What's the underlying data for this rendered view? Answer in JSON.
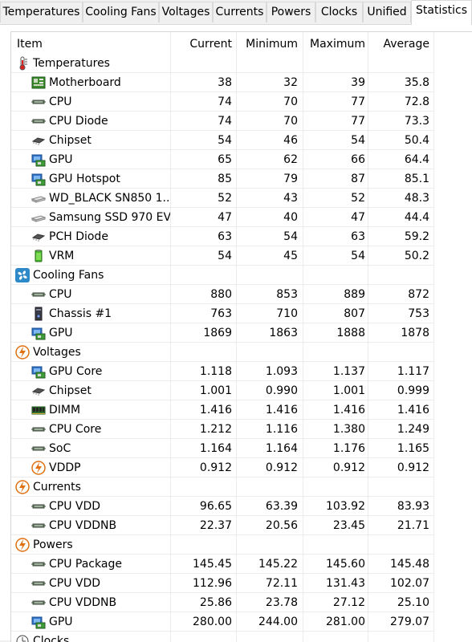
{
  "tabs": [
    {
      "label": "Temperatures",
      "active": false
    },
    {
      "label": "Cooling Fans",
      "active": false
    },
    {
      "label": "Voltages",
      "active": false
    },
    {
      "label": "Currents",
      "active": false
    },
    {
      "label": "Powers",
      "active": false
    },
    {
      "label": "Clocks",
      "active": false
    },
    {
      "label": "Unified",
      "active": false
    },
    {
      "label": "Statistics",
      "active": true
    }
  ],
  "columns": [
    "Item",
    "Current",
    "Minimum",
    "Maximum",
    "Average"
  ],
  "rows": [
    {
      "type": "group",
      "icon": "thermometer-icon",
      "item": "Temperatures"
    },
    {
      "type": "item",
      "icon": "motherboard-icon",
      "item": "Motherboard",
      "current": "38",
      "minimum": "32",
      "maximum": "39",
      "average": "35.8"
    },
    {
      "type": "item",
      "icon": "cpu-chip-icon",
      "item": "CPU",
      "current": "74",
      "minimum": "70",
      "maximum": "77",
      "average": "72.8"
    },
    {
      "type": "item",
      "icon": "cpu-chip-icon",
      "item": "CPU Diode",
      "current": "74",
      "minimum": "70",
      "maximum": "77",
      "average": "73.3"
    },
    {
      "type": "item",
      "icon": "chipset-icon",
      "item": "Chipset",
      "current": "54",
      "minimum": "46",
      "maximum": "54",
      "average": "50.4"
    },
    {
      "type": "item",
      "icon": "gpu-icon",
      "item": "GPU",
      "current": "65",
      "minimum": "62",
      "maximum": "66",
      "average": "64.4"
    },
    {
      "type": "item",
      "icon": "gpu-icon",
      "item": "GPU Hotspot",
      "current": "85",
      "minimum": "79",
      "maximum": "87",
      "average": "85.1"
    },
    {
      "type": "item",
      "icon": "ssd-icon",
      "item": "WD_BLACK SN850 1...",
      "current": "52",
      "minimum": "43",
      "maximum": "52",
      "average": "48.3"
    },
    {
      "type": "item",
      "icon": "ssd-icon",
      "item": "Samsung SSD 970 EV...",
      "current": "47",
      "minimum": "40",
      "maximum": "47",
      "average": "44.4"
    },
    {
      "type": "item",
      "icon": "chipset-icon",
      "item": "PCH Diode",
      "current": "63",
      "minimum": "54",
      "maximum": "63",
      "average": "59.2"
    },
    {
      "type": "item",
      "icon": "vrm-icon",
      "item": "VRM",
      "current": "54",
      "minimum": "45",
      "maximum": "54",
      "average": "50.2"
    },
    {
      "type": "group",
      "icon": "fan-icon",
      "item": "Cooling Fans"
    },
    {
      "type": "item",
      "icon": "cpu-chip-icon",
      "item": "CPU",
      "current": "880",
      "minimum": "853",
      "maximum": "889",
      "average": "872"
    },
    {
      "type": "item",
      "icon": "chassis-icon",
      "item": "Chassis #1",
      "current": "763",
      "minimum": "710",
      "maximum": "807",
      "average": "753"
    },
    {
      "type": "item",
      "icon": "gpu-icon",
      "item": "GPU",
      "current": "1869",
      "minimum": "1863",
      "maximum": "1888",
      "average": "1878"
    },
    {
      "type": "group",
      "icon": "lightning-icon",
      "item": "Voltages"
    },
    {
      "type": "item",
      "icon": "gpu-icon",
      "item": "GPU Core",
      "current": "1.118",
      "minimum": "1.093",
      "maximum": "1.137",
      "average": "1.117"
    },
    {
      "type": "item",
      "icon": "chipset-icon",
      "item": "Chipset",
      "current": "1.001",
      "minimum": "0.990",
      "maximum": "1.001",
      "average": "0.999"
    },
    {
      "type": "item",
      "icon": "dimm-icon",
      "item": "DIMM",
      "current": "1.416",
      "minimum": "1.416",
      "maximum": "1.416",
      "average": "1.416"
    },
    {
      "type": "item",
      "icon": "cpu-chip-icon",
      "item": "CPU Core",
      "current": "1.212",
      "minimum": "1.116",
      "maximum": "1.380",
      "average": "1.249"
    },
    {
      "type": "item",
      "icon": "cpu-chip-icon",
      "item": "SoC",
      "current": "1.164",
      "minimum": "1.164",
      "maximum": "1.176",
      "average": "1.165"
    },
    {
      "type": "item",
      "icon": "lightning-icon",
      "item": "VDDP",
      "current": "0.912",
      "minimum": "0.912",
      "maximum": "0.912",
      "average": "0.912"
    },
    {
      "type": "group",
      "icon": "lightning-icon",
      "item": "Currents"
    },
    {
      "type": "item",
      "icon": "cpu-chip-icon",
      "item": "CPU VDD",
      "current": "96.65",
      "minimum": "63.39",
      "maximum": "103.92",
      "average": "83.93"
    },
    {
      "type": "item",
      "icon": "cpu-chip-icon",
      "item": "CPU VDDNB",
      "current": "22.37",
      "minimum": "20.56",
      "maximum": "23.45",
      "average": "21.71"
    },
    {
      "type": "group",
      "icon": "lightning-icon",
      "item": "Powers"
    },
    {
      "type": "item",
      "icon": "cpu-chip-icon",
      "item": "CPU Package",
      "current": "145.45",
      "minimum": "145.22",
      "maximum": "145.60",
      "average": "145.48"
    },
    {
      "type": "item",
      "icon": "cpu-chip-icon",
      "item": "CPU VDD",
      "current": "112.96",
      "minimum": "72.11",
      "maximum": "131.43",
      "average": "102.07"
    },
    {
      "type": "item",
      "icon": "cpu-chip-icon",
      "item": "CPU VDDNB",
      "current": "25.86",
      "minimum": "23.78",
      "maximum": "27.12",
      "average": "25.10"
    },
    {
      "type": "item",
      "icon": "gpu-icon",
      "item": "GPU",
      "current": "280.00",
      "minimum": "244.00",
      "maximum": "281.00",
      "average": "279.07"
    },
    {
      "type": "group",
      "icon": "clock-icon",
      "item": "Clocks"
    }
  ]
}
